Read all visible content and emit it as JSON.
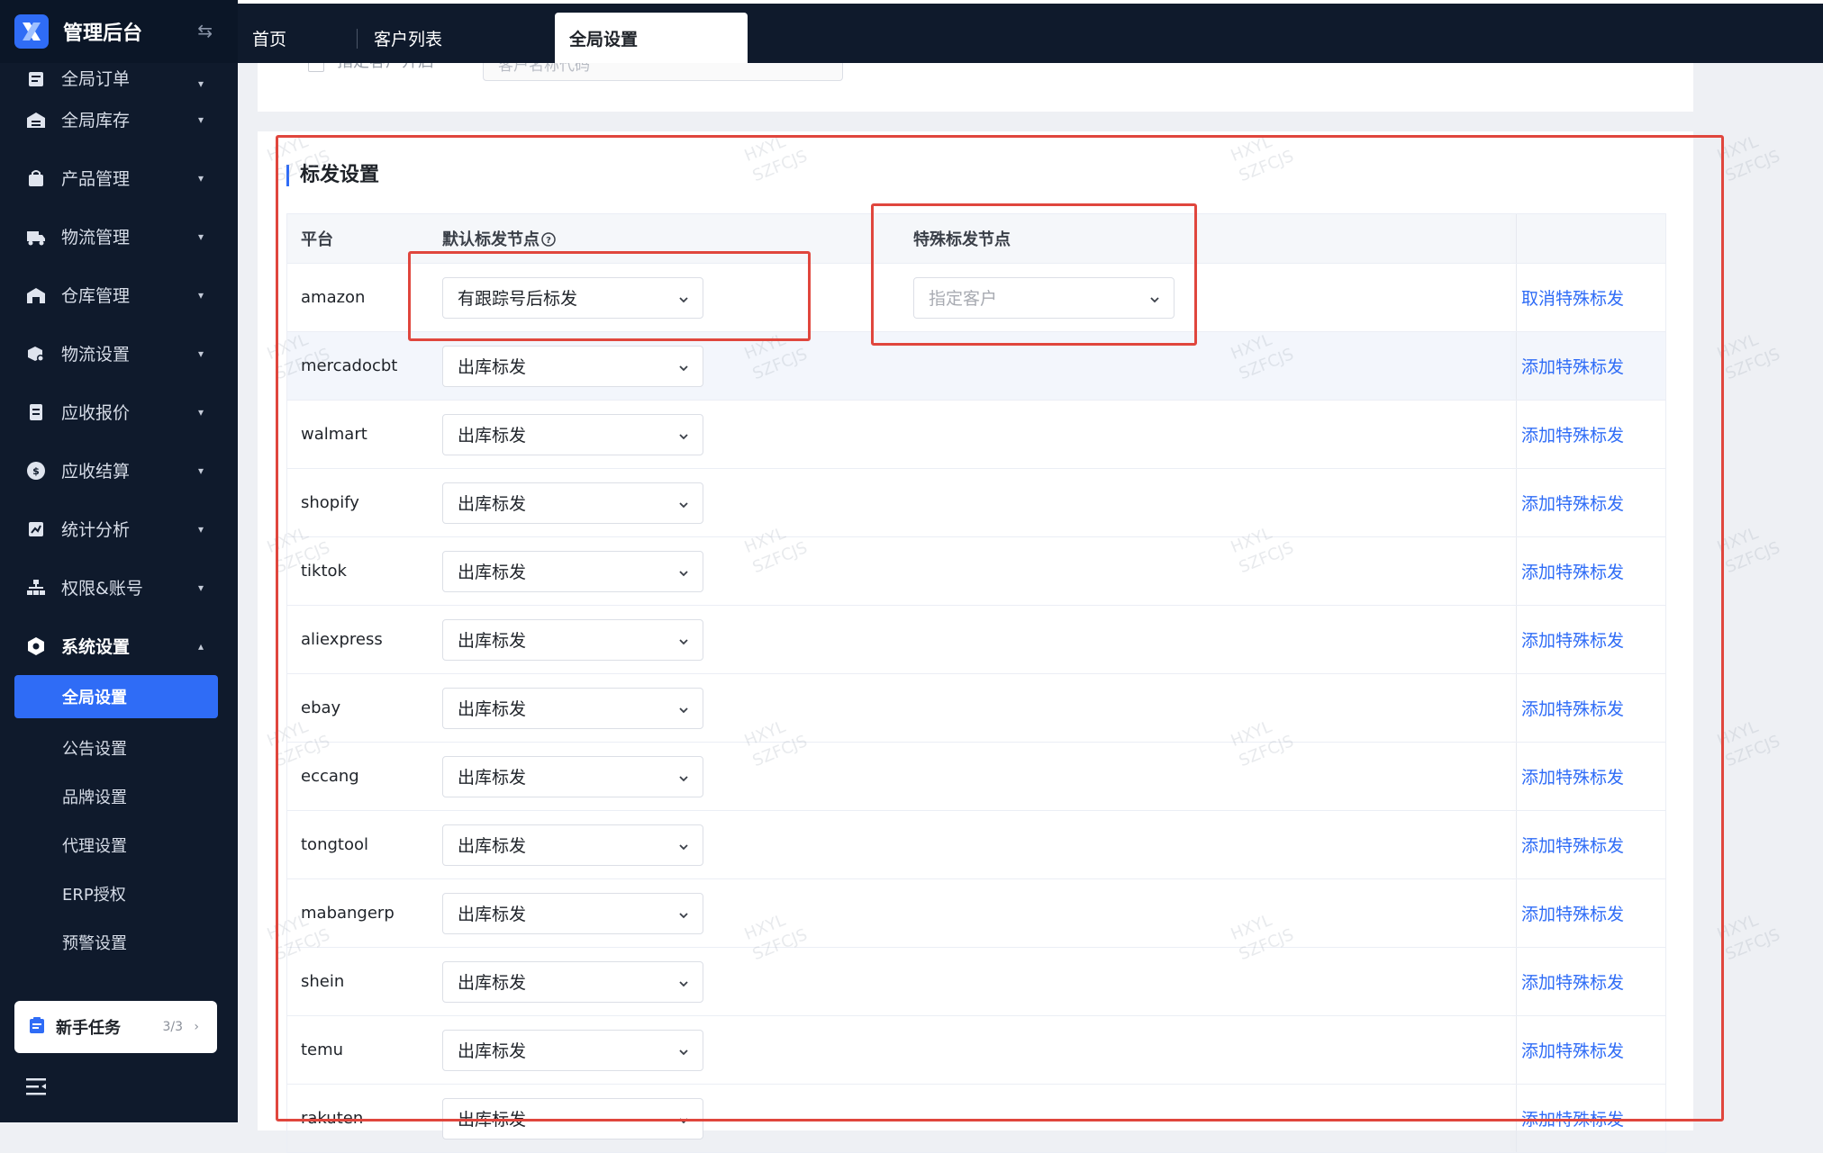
{
  "app": {
    "title": "管理后台"
  },
  "tabs": [
    {
      "label": "首页"
    },
    {
      "label": "客户列表"
    },
    {
      "label": "全局设置"
    }
  ],
  "sidebar": {
    "items": [
      {
        "label": "全局订单",
        "icon": "order-icon"
      },
      {
        "label": "全局库存",
        "icon": "inventory-icon"
      },
      {
        "label": "产品管理",
        "icon": "product-icon"
      },
      {
        "label": "物流管理",
        "icon": "truck-icon"
      },
      {
        "label": "仓库管理",
        "icon": "warehouse-icon"
      },
      {
        "label": "物流设置",
        "icon": "logistics-settings-icon"
      },
      {
        "label": "应收报价",
        "icon": "quote-icon"
      },
      {
        "label": "应收结算",
        "icon": "dollar-icon"
      },
      {
        "label": "统计分析",
        "icon": "chart-icon"
      },
      {
        "label": "权限&账号",
        "icon": "org-icon"
      },
      {
        "label": "系统设置",
        "icon": "settings-icon"
      }
    ],
    "subitems": [
      {
        "label": "全局设置"
      },
      {
        "label": "公告设置"
      },
      {
        "label": "品牌设置"
      },
      {
        "label": "代理设置"
      },
      {
        "label": "ERP授权"
      },
      {
        "label": "预警设置"
      }
    ],
    "task": {
      "label": "新手任务",
      "progress": "3/3"
    }
  },
  "previous_section": {
    "checkbox_label": "指定客户开启",
    "input_placeholder": "客户名称代码"
  },
  "section": {
    "title": "标发设置",
    "columns": {
      "platform": "平台",
      "default_node": "默认标发节点",
      "special_node": "特殊标发节点"
    },
    "rows": [
      {
        "platform": "amazon",
        "default": "有跟踪号后标发",
        "special": "指定客户",
        "action": "取消特殊标发"
      },
      {
        "platform": "mercadocbt",
        "default": "出库标发",
        "action": "添加特殊标发"
      },
      {
        "platform": "walmart",
        "default": "出库标发",
        "action": "添加特殊标发"
      },
      {
        "platform": "shopify",
        "default": "出库标发",
        "action": "添加特殊标发"
      },
      {
        "platform": "tiktok",
        "default": "出库标发",
        "action": "添加特殊标发"
      },
      {
        "platform": "aliexpress",
        "default": "出库标发",
        "action": "添加特殊标发"
      },
      {
        "platform": "ebay",
        "default": "出库标发",
        "action": "添加特殊标发"
      },
      {
        "platform": "eccang",
        "default": "出库标发",
        "action": "添加特殊标发"
      },
      {
        "platform": "tongtool",
        "default": "出库标发",
        "action": "添加特殊标发"
      },
      {
        "platform": "mabangerp",
        "default": "出库标发",
        "action": "添加特殊标发"
      },
      {
        "platform": "shein",
        "default": "出库标发",
        "action": "添加特殊标发"
      },
      {
        "platform": "temu",
        "default": "出库标发",
        "action": "添加特殊标发"
      },
      {
        "platform": "rakuten",
        "default": "出库标发",
        "action": "添加特殊标发"
      }
    ]
  },
  "watermark": [
    "HXYL",
    "SZFCJS"
  ],
  "colors": {
    "accent": "#2f6cf6",
    "sidebar": "#0f1a2c",
    "annotation": "#e0463d"
  }
}
